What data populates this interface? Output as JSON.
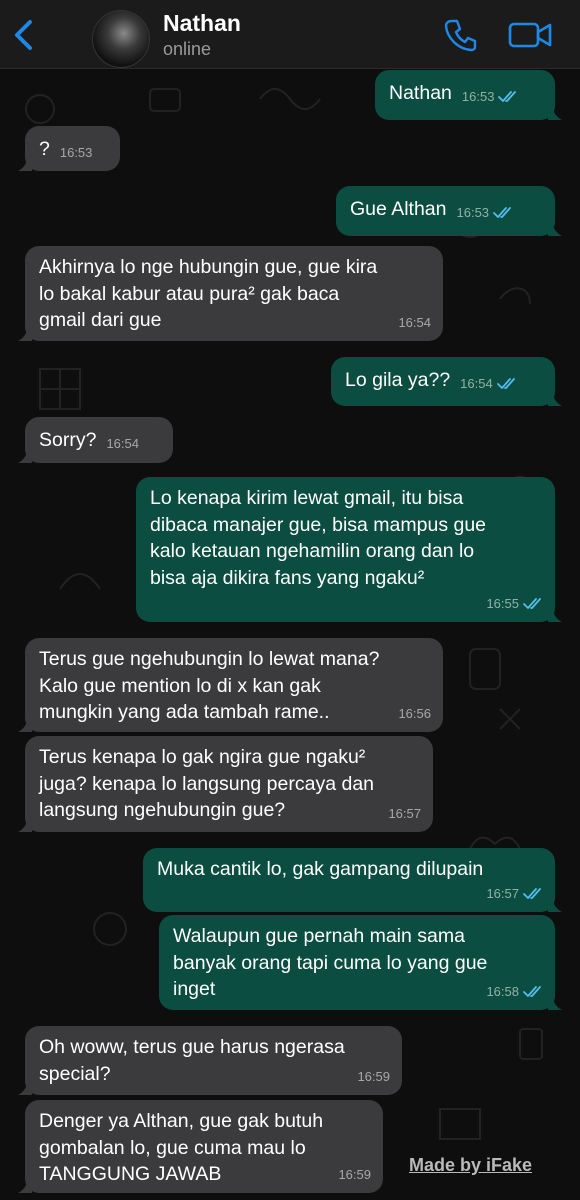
{
  "header": {
    "contact_name": "Nathan",
    "status": "online"
  },
  "colors": {
    "accent": "#1e88e5",
    "incoming_bubble": "#3b3b3d",
    "outgoing_bubble": "#0b4d40",
    "read_ticks": "#53bdeb"
  },
  "messages": [
    {
      "dir": "out",
      "text": "Nathan",
      "time": "16:53",
      "read": true
    },
    {
      "dir": "in",
      "text": "?",
      "time": "16:53"
    },
    {
      "dir": "out",
      "text": "Gue Althan",
      "time": "16:53",
      "read": true
    },
    {
      "dir": "in",
      "text": "Akhirnya lo nge hubungin gue, gue kira\nlo bakal kabur atau pura² gak baca\ngmail dari gue",
      "time": "16:54"
    },
    {
      "dir": "out",
      "text": "Lo gila ya??",
      "time": "16:54",
      "read": true
    },
    {
      "dir": "in",
      "text": "Sorry?",
      "time": "16:54"
    },
    {
      "dir": "out",
      "text": "Lo kenapa kirim lewat gmail, itu bisa\ndibaca manajer gue, bisa mampus gue\nkalo ketauan ngehamilin orang dan lo\nbisa aja dikira fans yang ngaku²",
      "time": "16:55",
      "read": true
    },
    {
      "dir": "in",
      "text": "Terus gue ngehubungin lo lewat mana?\nKalo gue mention lo di x kan gak\nmungkin yang ada tambah rame..",
      "time": "16:56"
    },
    {
      "dir": "in",
      "text": "Terus kenapa lo gak ngira gue ngaku²\njuga? kenapa lo langsung percaya dan\nlangsung ngehubungin gue?",
      "time": "16:57"
    },
    {
      "dir": "out",
      "text": "Muka cantik lo, gak gampang dilupain",
      "time": "16:57",
      "read": true
    },
    {
      "dir": "out",
      "text": "Walaupun gue pernah main sama\nbanyak orang tapi cuma lo yang gue\ninget",
      "time": "16:58",
      "read": true
    },
    {
      "dir": "in",
      "text": "Oh woww, terus gue harus ngerasa\nspecial?",
      "time": "16:59"
    },
    {
      "dir": "in",
      "text": "Denger ya Althan, gue gak butuh\ngombalan lo, gue cuma mau lo\nTANGGUNG JAWAB",
      "time": "16:59"
    }
  ],
  "watermark": "Made by iFake"
}
